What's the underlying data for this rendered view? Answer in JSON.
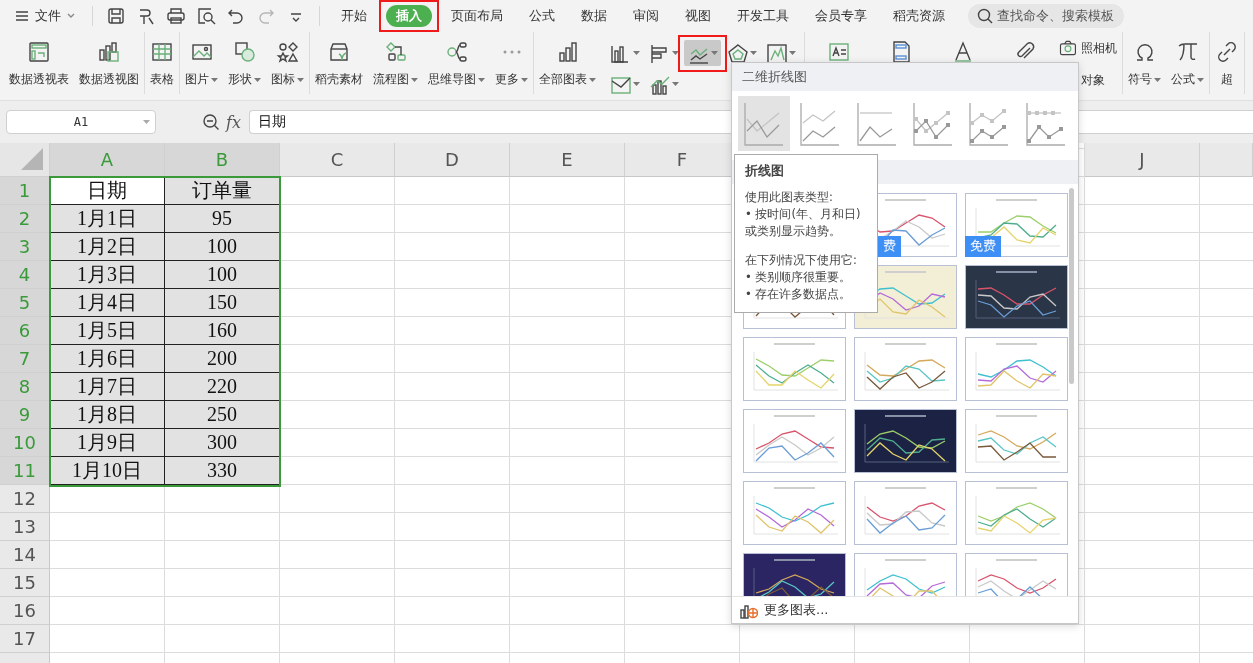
{
  "menu": {
    "label": "文件"
  },
  "quick_access": [
    {
      "disabled": false
    },
    {
      "disabled": false
    },
    {
      "disabled": false
    },
    {
      "disabled": false
    },
    {
      "disabled": false
    },
    {
      "disabled": true
    },
    {
      "disabled": false
    }
  ],
  "tabs": [
    {
      "label": "开始",
      "selected": false,
      "annotated": false
    },
    {
      "label": "插入",
      "selected": true,
      "annotated": true
    },
    {
      "label": "页面布局",
      "selected": false,
      "annotated": false
    },
    {
      "label": "公式",
      "selected": false,
      "annotated": false
    },
    {
      "label": "数据",
      "selected": false,
      "annotated": false
    },
    {
      "label": "审阅",
      "selected": false,
      "annotated": false
    },
    {
      "label": "视图",
      "selected": false,
      "annotated": false
    },
    {
      "label": "开发工具",
      "selected": false,
      "annotated": false
    },
    {
      "label": "会员专享",
      "selected": false,
      "annotated": false
    },
    {
      "label": "稻壳资源",
      "selected": false,
      "annotated": false
    }
  ],
  "search": {
    "placeholder": "查找命令、搜索模板"
  },
  "ribbon": [
    {
      "items": [
        {
          "kind": "large",
          "label": "数据透视表",
          "dropdown": false
        },
        {
          "kind": "large",
          "label": "数据透视图",
          "dropdown": false
        }
      ]
    },
    {
      "items": [
        {
          "kind": "large",
          "label": "表格",
          "dropdown": false
        }
      ]
    },
    {
      "items": [
        {
          "kind": "large",
          "label": "图片",
          "dropdown": true
        },
        {
          "kind": "large",
          "label": "形状",
          "dropdown": true
        },
        {
          "kind": "large",
          "label": "图标",
          "dropdown": true
        }
      ]
    },
    {
      "items": [
        {
          "kind": "large",
          "label": "稻壳素材",
          "dropdown": false
        },
        {
          "kind": "large",
          "label": "流程图",
          "dropdown": true
        },
        {
          "kind": "large",
          "label": "思维导图",
          "dropdown": true
        },
        {
          "kind": "large",
          "label": "更多",
          "dropdown": true
        }
      ]
    },
    {
      "items": [
        {
          "kind": "large",
          "label": "全部图表",
          "dropdown": true
        },
        {
          "kind": "charts",
          "buttons": [
            {
              "selected": false,
              "annotated": false
            },
            {
              "selected": false,
              "annotated": false
            },
            {
              "selected": true,
              "annotated": true
            },
            {
              "selected": false,
              "annotated": false
            },
            {
              "selected": false,
              "annotated": false
            },
            {
              "selected": false,
              "annotated": false
            },
            {
              "selected": false,
              "annotated": false
            }
          ]
        }
      ]
    },
    {
      "items": [
        {
          "kind": "icon"
        },
        {
          "kind": "icon"
        },
        {
          "kind": "icon"
        },
        {
          "kind": "icon"
        },
        {
          "kind": "stack",
          "label": "照相机",
          "caption": "对象"
        }
      ]
    },
    {
      "items": [
        {
          "kind": "large",
          "label": "符号",
          "dropdown": true
        },
        {
          "kind": "large",
          "label": "公式",
          "dropdown": true
        }
      ]
    },
    {
      "items": [
        {
          "kind": "large",
          "label": "超",
          "dropdown": false
        }
      ]
    }
  ],
  "formula_bar": {
    "cell": "A1",
    "function_label": "fx",
    "value": "日期"
  },
  "sheet": {
    "columns": [
      {
        "label": "A",
        "selected": true
      },
      {
        "label": "B",
        "selected": true
      },
      {
        "label": "C",
        "selected": false
      },
      {
        "label": "D",
        "selected": false
      },
      {
        "label": "E",
        "selected": false
      },
      {
        "label": "F",
        "selected": false
      },
      {
        "label": "J",
        "selected": false
      }
    ],
    "rows": [
      {
        "number": "1",
        "selected": true,
        "cells": [
          {
            "text": "日期",
            "active": true
          },
          {
            "text": "订单量",
            "active": false
          }
        ]
      },
      {
        "number": "2",
        "selected": true,
        "cells": [
          {
            "text": "1月1日",
            "active": false
          },
          {
            "text": "95",
            "active": false
          }
        ]
      },
      {
        "number": "3",
        "selected": true,
        "cells": [
          {
            "text": "1月2日",
            "active": false
          },
          {
            "text": "100",
            "active": false
          }
        ]
      },
      {
        "number": "4",
        "selected": true,
        "cells": [
          {
            "text": "1月3日",
            "active": false
          },
          {
            "text": "100",
            "active": false
          }
        ]
      },
      {
        "number": "5",
        "selected": true,
        "cells": [
          {
            "text": "1月4日",
            "active": false
          },
          {
            "text": "150",
            "active": false
          }
        ]
      },
      {
        "number": "6",
        "selected": true,
        "cells": [
          {
            "text": "1月5日",
            "active": false
          },
          {
            "text": "160",
            "active": false
          }
        ]
      },
      {
        "number": "7",
        "selected": true,
        "cells": [
          {
            "text": "1月6日",
            "active": false
          },
          {
            "text": "200",
            "active": false
          }
        ]
      },
      {
        "number": "8",
        "selected": true,
        "cells": [
          {
            "text": "1月7日",
            "active": false
          },
          {
            "text": "220",
            "active": false
          }
        ]
      },
      {
        "number": "9",
        "selected": true,
        "cells": [
          {
            "text": "1月8日",
            "active": false
          },
          {
            "text": "250",
            "active": false
          }
        ]
      },
      {
        "number": "10",
        "selected": true,
        "cells": [
          {
            "text": "1月9日",
            "active": false
          },
          {
            "text": "300",
            "active": false
          }
        ]
      },
      {
        "number": "11",
        "selected": true,
        "cells": [
          {
            "text": "1月10日",
            "active": false
          },
          {
            "text": "330",
            "active": false
          }
        ]
      },
      {
        "number": "12",
        "selected": false
      },
      {
        "number": "13",
        "selected": false
      },
      {
        "number": "14",
        "selected": false
      },
      {
        "number": "15",
        "selected": false
      },
      {
        "number": "16",
        "selected": false
      },
      {
        "number": "17",
        "selected": false
      }
    ]
  },
  "chart_menu": {
    "heading": "二维折线图",
    "types": [
      {
        "kind": "line",
        "selected": true
      },
      {
        "kind": "stacked",
        "selected": false
      },
      {
        "kind": "percent",
        "selected": false
      },
      {
        "kind": "marker",
        "selected": false
      },
      {
        "kind": "stacked-marker",
        "selected": false
      },
      {
        "kind": "percent-marker",
        "selected": false
      }
    ],
    "tooltip": {
      "title": "折线图",
      "paragraphs": [
        [
          "使用此图表类型:",
          "• 按时间(年、月和日)",
          "或类别显示趋势。"
        ],
        [
          "在下列情况下使用它:",
          "• 类别顺序很重要。",
          "• 存在许多数据点。"
        ]
      ]
    },
    "templates": [
      {
        "kind": "light",
        "badge": "费"
      },
      {
        "kind": "light",
        "badge": "免费"
      },
      {
        "kind": "light"
      },
      {
        "kind": "cream"
      },
      {
        "kind": "dark"
      },
      {
        "kind": "light"
      },
      {
        "kind": "light"
      },
      {
        "kind": "light"
      },
      {
        "kind": "light"
      },
      {
        "kind": "navy"
      },
      {
        "kind": "light"
      },
      {
        "kind": "light"
      },
      {
        "kind": "light"
      },
      {
        "kind": "light"
      },
      {
        "kind": "purple"
      },
      {
        "kind": "light"
      },
      {
        "kind": "light"
      }
    ],
    "more": "更多图表..."
  }
}
